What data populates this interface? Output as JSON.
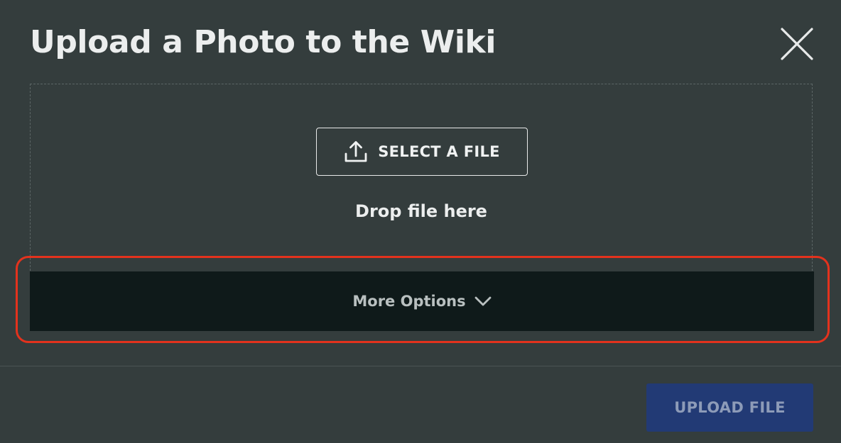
{
  "dialog": {
    "title": "Upload a Photo to the Wiki",
    "close_icon": "close-icon"
  },
  "dropzone": {
    "select_button_label": "SELECT A FILE",
    "select_icon": "upload-icon",
    "drop_hint": "Drop file here"
  },
  "more_options": {
    "label": "More Options",
    "icon": "chevron-down-icon",
    "highlight_color": "#e3321d"
  },
  "footer": {
    "upload_button_label": "UPLOAD FILE",
    "upload_button_state": "disabled"
  },
  "colors": {
    "background": "#343d3d",
    "more_options_bar": "#0f1a1a",
    "upload_button": "#223a75"
  }
}
